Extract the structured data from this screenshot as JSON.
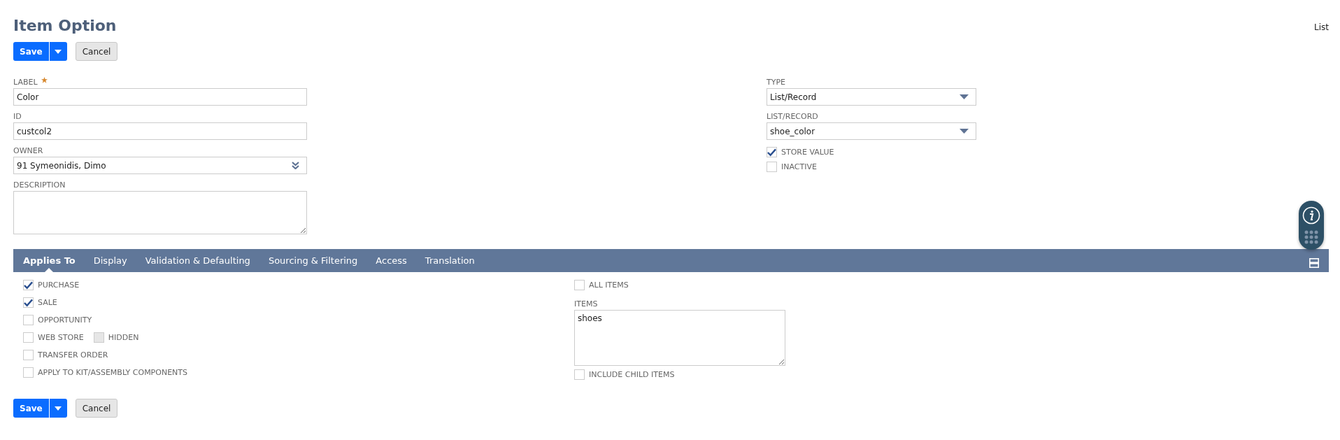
{
  "page": {
    "title": "Item Option",
    "list_link": "List"
  },
  "top_buttons": {
    "save": "Save",
    "cancel": "Cancel"
  },
  "left_fields": [
    {
      "label": "LABEL",
      "required": true,
      "kind": "text",
      "value": "Color"
    },
    {
      "label": "ID",
      "required": false,
      "kind": "text",
      "value": "custcol2"
    },
    {
      "label": "OWNER",
      "required": false,
      "kind": "combo",
      "value": "91 Symeonidis, Dimo"
    },
    {
      "label": "DESCRIPTION",
      "required": false,
      "kind": "textarea"
    }
  ],
  "right_fields": [
    {
      "label": "TYPE",
      "kind": "select",
      "value": "List/Record"
    },
    {
      "label": "LIST/RECORD",
      "kind": "select",
      "value": "shoe_color"
    }
  ],
  "right_checks": [
    {
      "label": "STORE VALUE",
      "checked": true
    },
    {
      "label": "INACTIVE",
      "checked": false
    }
  ],
  "tabs": [
    {
      "label": "Applies To",
      "selected": true
    },
    {
      "label": "Display",
      "selected": false
    },
    {
      "label": "Validation & Defaulting",
      "selected": false
    },
    {
      "label": "Sourcing & Filtering",
      "selected": false
    },
    {
      "label": "Access",
      "selected": false
    },
    {
      "label": "Translation",
      "selected": false
    }
  ],
  "applies_to": [
    [
      {
        "label": "PURCHASE",
        "checked": true,
        "disabled": false
      }
    ],
    [
      {
        "label": "SALE",
        "checked": true,
        "disabled": false
      }
    ],
    [
      {
        "label": "OPPORTUNITY",
        "checked": false,
        "disabled": false
      }
    ],
    [
      {
        "label": "WEB STORE",
        "checked": false,
        "disabled": false
      },
      {
        "label": "HIDDEN",
        "checked": false,
        "disabled": true
      }
    ],
    [
      {
        "label": "TRANSFER ORDER",
        "checked": false,
        "disabled": false
      }
    ],
    [
      {
        "label": "APPLY TO KIT/ASSEMBLY COMPONENTS",
        "checked": false,
        "disabled": false
      }
    ]
  ],
  "items_panel": {
    "all_items": {
      "label": "ALL ITEMS",
      "checked": false
    },
    "items_label": "ITEMS",
    "items_value": "shoes",
    "include_child": {
      "label": "INCLUDE CHILD ITEMS",
      "checked": false
    }
  },
  "bottom_buttons": {
    "save": "Save",
    "cancel": "Cancel"
  }
}
